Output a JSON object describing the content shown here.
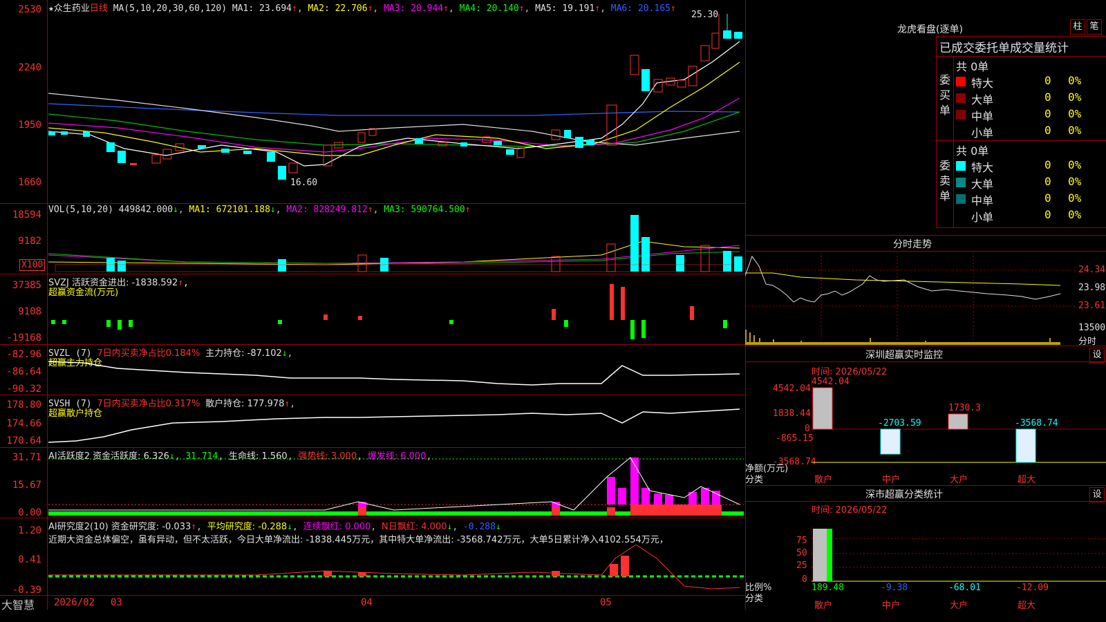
{
  "stock": {
    "name": "众生药业",
    "period": "日线"
  },
  "ma_line": {
    "label": "MA(5,10,20,30,60,120)",
    "ma1": "MA1: 23.694",
    "ma2": "MA2: 22.706",
    "ma3": "MA3: 20.944",
    "ma4": "MA4: 20.140",
    "ma5": "MA5: 19.191",
    "ma6": "MA6: 20.165"
  },
  "price_axis": [
    "2530",
    "2240",
    "1950",
    "1660"
  ],
  "annotations": {
    "high": "25.30",
    "low": "16.60"
  },
  "vol": {
    "label": "VOL(5,10,20)",
    "value": "449842.000",
    "ma1": "MA1: 672101.188",
    "ma2": "MA2: 828249.812",
    "ma3": "MA3: 590764.500",
    "axis": [
      "18594",
      "9182",
      "X100"
    ]
  },
  "svzj": {
    "label": "SVZJ  活跃资金进出: -1838.592",
    "sub": "超赢资金流(万元)",
    "axis": [
      "37385",
      "9108",
      "-19168"
    ]
  },
  "svzl": {
    "label": "SVZL (7) ",
    "ratio": "7日内买卖净占比0.184%",
    "hold": "主力持仓: -87.102",
    "sub": "超赢主力持仓",
    "axis": [
      "-82.96",
      "-86.64",
      "-90.32"
    ]
  },
  "svsh": {
    "label": "SVSH (7) ",
    "ratio": "7日内买卖净占比0.317%",
    "hold": "散户持仓: 177.978",
    "sub": "超赢散户持仓",
    "axis": [
      "178.80",
      "174.66",
      "170.64"
    ]
  },
  "ai_act": {
    "label": "AI活跃度2 资金活跃度: 6.326",
    "v2": "31.714",
    "life": "生命线: 1.560",
    "strong": "强势线: 3.000",
    "burst": "爆发线: 6.000",
    "axis": [
      "31.71",
      "15.67",
      "0.00"
    ]
  },
  "ai_res": {
    "label": "AI研究度2(10) 资金研究度: -0.033",
    "avg": "平均研究度: -0.288",
    "cont": "连续飘红: 0.000",
    "nday": "N日飘红: 4.000",
    "last": "-0.288",
    "text": "近期大资金总体偏空，虽有异动，但不太活跃，今日大单净流出: -1838.445万元，其中特大单净流出: -3568.742万元，大单5日累计净入4102.554万元，",
    "axis": [
      "1.20",
      "0.41",
      "-0.39"
    ]
  },
  "bottom": {
    "brand": "大智慧",
    "date": "2026/02",
    "m1": "03",
    "m2": "04",
    "m3": "05"
  },
  "right": {
    "title": "龙虎看盘(逐单)",
    "btn1": "柱",
    "btn2": "笔",
    "stat_title": "已成交委托单成交量统计",
    "buy": {
      "side": "委买单",
      "total": "共 0单",
      "rows": [
        {
          "name": "特大",
          "n": "0",
          "p": "0%"
        },
        {
          "name": "大单",
          "n": "0",
          "p": "0%"
        },
        {
          "name": "中单",
          "n": "0",
          "p": "0%"
        },
        {
          "name": "小单",
          "n": "0",
          "p": "0%"
        }
      ]
    },
    "sell": {
      "side": "委卖单",
      "total": "共 0单",
      "rows": [
        {
          "name": "特大",
          "n": "0",
          "p": "0%"
        },
        {
          "name": "大单",
          "n": "0",
          "p": "0%"
        },
        {
          "name": "中单",
          "n": "0",
          "p": "0%"
        },
        {
          "name": "小单",
          "n": "0",
          "p": "0%"
        }
      ]
    },
    "intraday": {
      "title": "分时走势",
      "axis": [
        "24.34",
        "23.98",
        "23.61"
      ],
      "vol": "13500",
      "unit": "分时"
    },
    "monitor": {
      "title": "深圳超赢实时监控",
      "btn": "设",
      "time": "时间: 2026/05/22",
      "axis": [
        "4542.04",
        "1838.44",
        "0",
        "-865.15",
        "-3568.74"
      ],
      "values": [
        "4542.04",
        "-2703.59",
        "1730.3",
        "-3568.74"
      ],
      "ylabel": "净额(万元)",
      "xlabel": "分类",
      "cats": [
        "散户",
        "中户",
        "大户",
        "超大"
      ]
    },
    "classify": {
      "title": "深市超赢分类统计",
      "btn": "设",
      "time": "时间: 2026/05/22",
      "axis": [
        "75",
        "50",
        "25",
        "0"
      ],
      "values": [
        "189.48",
        "-9.38",
        "-68.01",
        "-12.09"
      ],
      "ylabel": "比例%",
      "xlabel": "分类",
      "cats": [
        "散户",
        "中户",
        "大户",
        "超大"
      ]
    }
  },
  "colors": {
    "up": "#ff3030",
    "down": "#00ffff",
    "grid": "#a00000"
  }
}
